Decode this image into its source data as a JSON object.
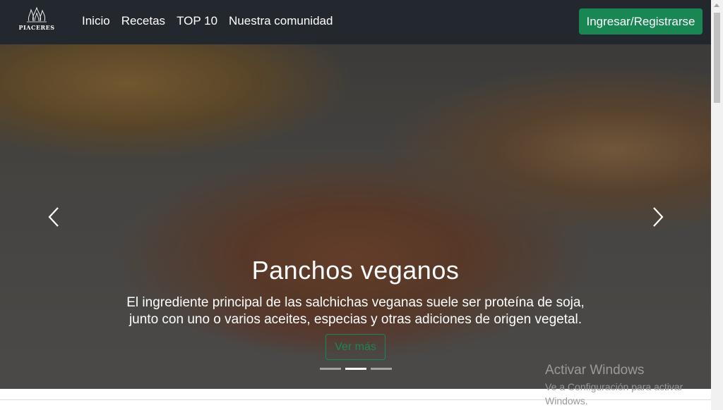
{
  "navbar": {
    "brand": "PIACERES",
    "links": [
      "Inicio",
      "Recetas",
      "TOP 10",
      "Nuestra comunidad"
    ],
    "login_label": "Ingresar/Registrarse"
  },
  "carousel": {
    "title": "Panchos veganos",
    "text_line1": "El ingrediente principal de las salchichas veganas suele ser proteína de soja,",
    "text_line2": "junto con uno o varios aceites, especias y otras adiciones de origen vegetal.",
    "more_label": "Ver más",
    "slide_count": 3,
    "active_slide": 2,
    "prev_icon": "chevron-left-icon",
    "next_icon": "chevron-right-icon"
  },
  "watermark": {
    "title": "Activar Windows",
    "subtitle": "Ve a Configuración para activar Windows."
  },
  "colors": {
    "navbar_bg": "#23282e",
    "accent_green": "#198754"
  }
}
